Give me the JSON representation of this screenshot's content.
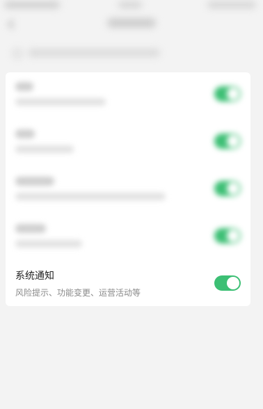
{
  "status_bar": {
    "left_text": "",
    "center_text": "",
    "right_text": ""
  },
  "nav": {
    "title": ""
  },
  "hint": {
    "text": ""
  },
  "settings": [
    {
      "title": "",
      "subtitle": "",
      "enabled": true
    },
    {
      "title": "",
      "subtitle": "",
      "enabled": true
    },
    {
      "title": "",
      "subtitle": "",
      "enabled": true
    },
    {
      "title": "",
      "subtitle": "",
      "enabled": true
    },
    {
      "title": "系统通知",
      "subtitle": "风险提示、功能变更、运营活动等",
      "enabled": true
    }
  ],
  "colors": {
    "toggle_on": "#3cbf74",
    "background": "#f3f3f3",
    "card": "#ffffff"
  },
  "icons": {
    "back": "chevron-left-icon",
    "hint": "info-icon"
  }
}
